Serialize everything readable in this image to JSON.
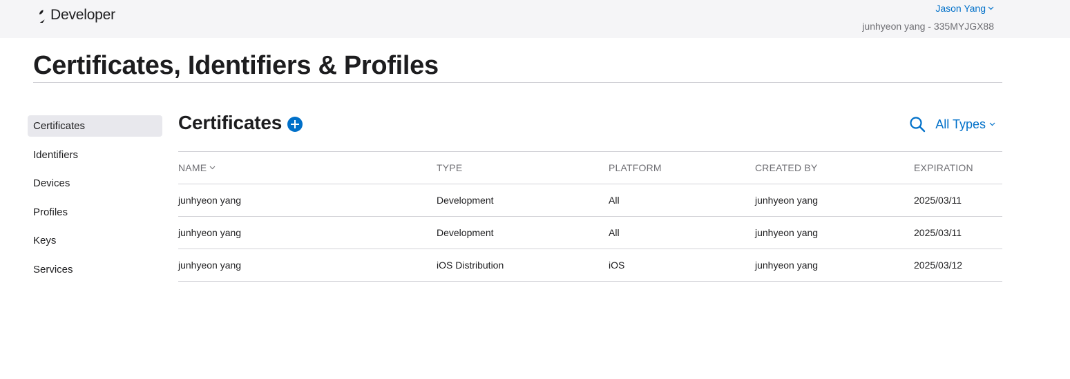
{
  "header": {
    "brand": "Developer",
    "user_name": "Jason Yang",
    "team": "junhyeon yang - 335MYJGX88"
  },
  "page_title": "Certificates, Identifiers & Profiles",
  "sidebar": {
    "items": [
      {
        "label": "Certificates",
        "active": true
      },
      {
        "label": "Identifiers"
      },
      {
        "label": "Devices"
      },
      {
        "label": "Profiles"
      },
      {
        "label": "Keys"
      },
      {
        "label": "Services"
      }
    ]
  },
  "section": {
    "title": "Certificates",
    "filter_label": "All Types"
  },
  "table": {
    "columns": [
      "NAME",
      "TYPE",
      "PLATFORM",
      "CREATED BY",
      "EXPIRATION"
    ],
    "rows": [
      [
        "junhyeon yang",
        "Development",
        "All",
        "junhyeon yang",
        "2025/03/11"
      ],
      [
        "junhyeon yang",
        "Development",
        "All",
        "junhyeon yang",
        "2025/03/11"
      ],
      [
        "junhyeon yang",
        "iOS Distribution",
        "iOS",
        "junhyeon yang",
        "2025/03/12"
      ]
    ]
  },
  "colors": {
    "accent": "#0070c9",
    "topbar_bg": "#f5f5f7",
    "active_item_bg": "#e8e8ed",
    "divider": "#d2d2d7"
  },
  "icons": [
    "apple-logo-icon",
    "chevron-down-icon",
    "plus-circle-icon",
    "search-icon"
  ]
}
